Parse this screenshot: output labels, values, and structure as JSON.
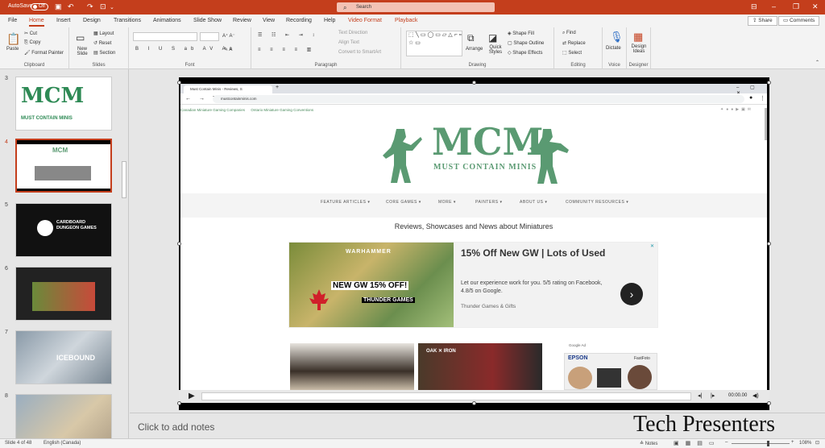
{
  "titlebar": {
    "autosave": "AutoSave",
    "autosave_state": "Off",
    "search_label": "Search"
  },
  "tabs": [
    "File",
    "Home",
    "Insert",
    "Design",
    "Transitions",
    "Animations",
    "Slide Show",
    "Review",
    "View",
    "Recording",
    "Help",
    "Video Format",
    "Playback"
  ],
  "share": "Share",
  "comments": "Comments",
  "ribbon": {
    "clipboard": {
      "label": "Clipboard",
      "paste": "Paste",
      "cut": "Cut",
      "copy": "Copy",
      "format_painter": "Format Painter"
    },
    "slides": {
      "label": "Slides",
      "new_slide": "New Slide",
      "layout": "Layout",
      "reset": "Reset",
      "section": "Section"
    },
    "font": {
      "label": "Font"
    },
    "paragraph": {
      "label": "Paragraph",
      "text_direction": "Text Direction",
      "align_text": "Align Text",
      "convert": "Convert to SmartArt"
    },
    "drawing": {
      "label": "Drawing",
      "arrange": "Arrange",
      "quick_styles": "Quick Styles",
      "shape_fill": "Shape Fill",
      "shape_outline": "Shape Outline",
      "shape_effects": "Shape Effects"
    },
    "editing": {
      "label": "Editing",
      "find": "Find",
      "replace": "Replace",
      "select": "Select"
    },
    "voice": {
      "label": "Voice",
      "dictate": "Dictate"
    },
    "designer": {
      "label": "Designer",
      "design_ideas": "Design Ideas"
    }
  },
  "thumbnails": [
    {
      "num": "3",
      "star": "*"
    },
    {
      "num": "4",
      "star": "*"
    },
    {
      "num": "5",
      "star": "*",
      "text": "CARDBOARD DUNGEON GAMES"
    },
    {
      "num": "6",
      "star": "*"
    },
    {
      "num": "7",
      "star": "*",
      "text": "ICEBOUND"
    },
    {
      "num": "8",
      "star": "*"
    }
  ],
  "browser": {
    "tab_title": "Must Contain Minis - Reviews, S",
    "url": "mustcontainminis.com",
    "topnav": [
      "Canadian Miniature Gaming Companies",
      "Ontario Miniature Gaming Conventions"
    ],
    "logo_big": "MCM",
    "logo_sub": "MUST CONTAIN MINIS",
    "menu": [
      "FEATURE ARTICLES",
      "CORE GAMES",
      "MORE",
      "PAINTERS",
      "ABOUT US",
      "COMMUNITY RESOURCES"
    ],
    "tagline": "Reviews, Showcases and News about Miniatures",
    "ad": {
      "headline": "15% Off New GW | Lots of Used",
      "text": "Let our experience work for you. 5/5 rating on Facebook, 4.8/5 on Google.",
      "source": "Thunder Games & Gifts",
      "img_line1": "WARHAMMER",
      "img_line2": "NEW GW 15% OFF!",
      "img_line3": "THUNDER GAMES"
    },
    "google_ad": "Google Ad",
    "epson": "EPSON",
    "fastfoto": "FastFoto"
  },
  "video": {
    "time": "00:00.00"
  },
  "notes_placeholder": "Click to add notes",
  "watermark": "Tech Presenters",
  "status": {
    "slide": "Slide 4 of 48",
    "language": "English (Canada)",
    "notes": "Notes",
    "zoom": "108%"
  }
}
